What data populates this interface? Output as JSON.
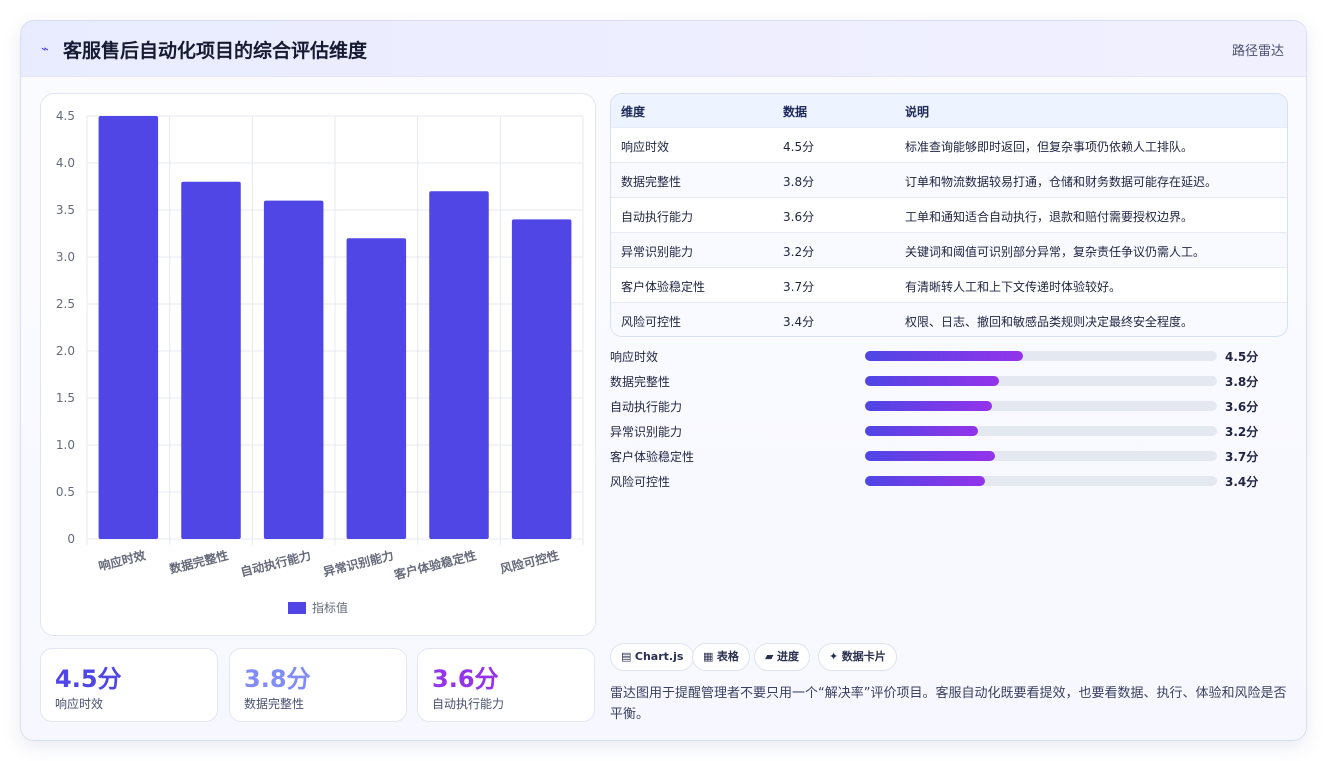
{
  "header": {
    "icon": "spark-icon",
    "title": "客服售后自动化项目的综合评估维度",
    "tag": "路径雷达"
  },
  "colors": {
    "accent": "#4f46e5",
    "kpi": [
      "#4f46e5",
      "#818cf8",
      "#9333ea"
    ],
    "progress_start": "#4f46e5",
    "progress_end": "#9333ea"
  },
  "chart_data": {
    "type": "bar",
    "categories": [
      "响应时效",
      "数据完整性",
      "自动执行能力",
      "异常识别能力",
      "客户体验稳定性",
      "风险可控性"
    ],
    "series": [
      {
        "name": "指标值",
        "values": [
          4.5,
          3.8,
          3.6,
          3.2,
          3.7,
          3.4
        ],
        "color": "#4f46e5"
      }
    ],
    "ylim": [
      0,
      4.5
    ],
    "yticks": [
      0,
      0.5,
      1.0,
      1.5,
      2.0,
      2.5,
      3.0,
      3.5,
      4.0,
      4.5
    ],
    "ytick_labels": [
      "0",
      "0.5",
      "1.0",
      "1.5",
      "2.0",
      "2.5",
      "3.0",
      "3.5",
      "4.0",
      "4.5"
    ],
    "grid": true,
    "legend": "bottom",
    "title": "",
    "xlabel": "",
    "ylabel": ""
  },
  "kpis": [
    {
      "value": "4.5分",
      "label": "响应时效"
    },
    {
      "value": "3.8分",
      "label": "数据完整性"
    },
    {
      "value": "3.6分",
      "label": "自动执行能力"
    }
  ],
  "table": {
    "headers": [
      "维度",
      "数据",
      "说明"
    ],
    "rows": [
      [
        "响应时效",
        "4.5分",
        "标准查询能够即时返回，但复杂事项仍依赖人工排队。"
      ],
      [
        "数据完整性",
        "3.8分",
        "订单和物流数据较易打通，仓储和财务数据可能存在延迟。"
      ],
      [
        "自动执行能力",
        "3.6分",
        "工单和通知适合自动执行，退款和赔付需要授权边界。"
      ],
      [
        "异常识别能力",
        "3.2分",
        "关键词和阈值可识别部分异常，复杂责任争议仍需人工。"
      ],
      [
        "客户体验稳定性",
        "3.7分",
        "有清晰转人工和上下文传递时体验较好。"
      ],
      [
        "风险可控性",
        "3.4分",
        "权限、日志、撤回和敏感品类规则决定最终安全程度。"
      ]
    ]
  },
  "progress": {
    "max": 10,
    "items": [
      {
        "label": "响应时效",
        "value": 4.5,
        "text": "4.5分"
      },
      {
        "label": "数据完整性",
        "value": 3.8,
        "text": "3.8分"
      },
      {
        "label": "自动执行能力",
        "value": 3.6,
        "text": "3.6分"
      },
      {
        "label": "异常识别能力",
        "value": 3.2,
        "text": "3.2分"
      },
      {
        "label": "客户体验稳定性",
        "value": 3.7,
        "text": "3.7分"
      },
      {
        "label": "风险可控性",
        "value": 3.4,
        "text": "3.4分"
      }
    ]
  },
  "chips": [
    {
      "icon": "▤",
      "label": "Chart.js"
    },
    {
      "icon": "▦",
      "label": "表格"
    },
    {
      "icon": "▰",
      "label": "进度"
    },
    {
      "icon": "✦",
      "label": "数据卡片"
    }
  ],
  "note": "雷达图用于提醒管理者不要只用一个“解决率”评价项目。客服自动化既要看提效，也要看数据、执行、体验和风险是否平衡。"
}
